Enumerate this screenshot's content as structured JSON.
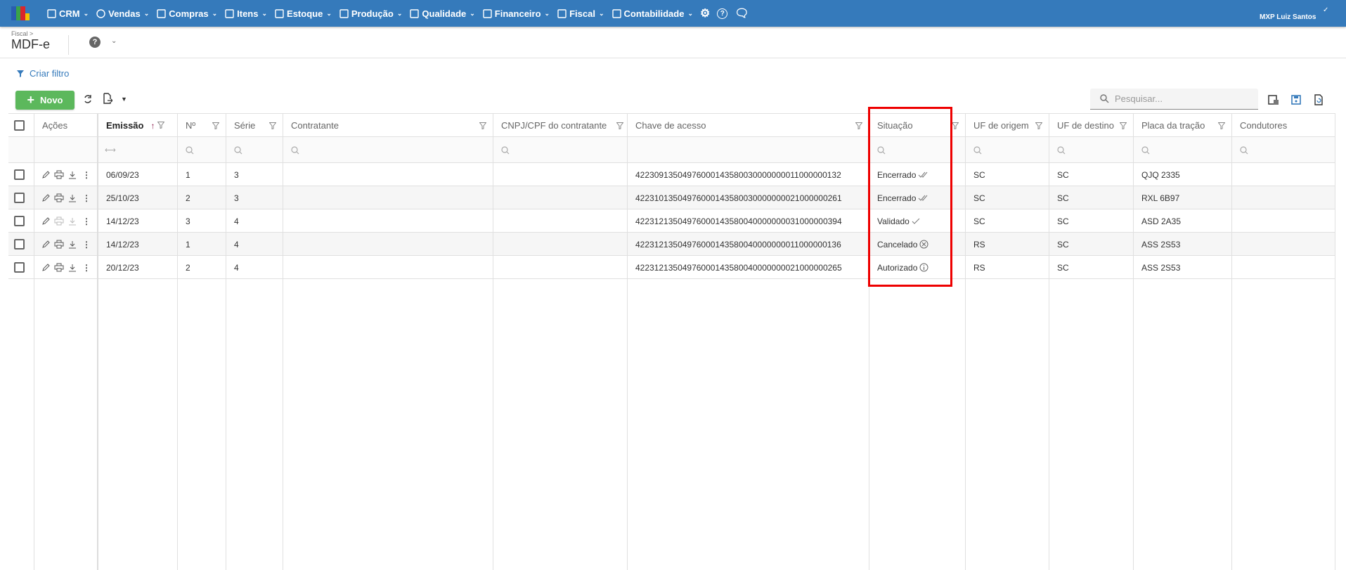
{
  "topbar": {
    "brand_colors": [
      "#2a5db0",
      "#3aa34a",
      "#d9262c",
      "#f4c400"
    ],
    "nav": [
      {
        "label": "CRM",
        "icon": "crm-icon"
      },
      {
        "label": "Vendas",
        "icon": "dollar-circle-icon"
      },
      {
        "label": "Compras",
        "icon": "cart-icon"
      },
      {
        "label": "Itens",
        "icon": "items-icon"
      },
      {
        "label": "Estoque",
        "icon": "stock-icon"
      },
      {
        "label": "Produção",
        "icon": "factory-icon"
      },
      {
        "label": "Qualidade",
        "icon": "checklist-icon"
      },
      {
        "label": "Financeiro",
        "icon": "money-bag-icon"
      },
      {
        "label": "Fiscal",
        "icon": "document-icon"
      },
      {
        "label": "Contabilidade",
        "icon": "calculator-icon"
      }
    ],
    "user": "MXP Luiz Santos"
  },
  "page": {
    "breadcrumb": "Fiscal >",
    "title": "MDF-e"
  },
  "toolbar": {
    "create_filter": "Criar filtro",
    "new_label": "Novo",
    "search_placeholder": "Pesquisar..."
  },
  "table": {
    "columns": [
      "Ações",
      "Emissão",
      "Nº",
      "Série",
      "Contratante",
      "CNPJ/CPF do contratante",
      "Chave de acesso",
      "Situação",
      "UF de origem",
      "UF de destino",
      "Placa da tração",
      "Condutores"
    ],
    "rows": [
      {
        "emissao": "06/09/23",
        "numero": "1",
        "serie": "3",
        "contratante": "",
        "cnpj": "",
        "chave": "42230913504976000143580030000000011000000132",
        "situacao": "Encerrado",
        "status_icon": "double-check",
        "uf_origem": "SC",
        "uf_destino": "SC",
        "placa": "QJQ 2335",
        "condutores": "",
        "print_enabled": true
      },
      {
        "emissao": "25/10/23",
        "numero": "2",
        "serie": "3",
        "contratante": "",
        "cnpj": "",
        "chave": "42231013504976000143580030000000021000000261",
        "situacao": "Encerrado",
        "status_icon": "double-check",
        "uf_origem": "SC",
        "uf_destino": "SC",
        "placa": "RXL 6B97",
        "condutores": "",
        "print_enabled": true
      },
      {
        "emissao": "14/12/23",
        "numero": "3",
        "serie": "4",
        "contratante": "",
        "cnpj": "",
        "chave": "42231213504976000143580040000000031000000394",
        "situacao": "Validado",
        "status_icon": "check",
        "uf_origem": "SC",
        "uf_destino": "SC",
        "placa": "ASD 2A35",
        "condutores": "",
        "print_enabled": false
      },
      {
        "emissao": "14/12/23",
        "numero": "1",
        "serie": "4",
        "contratante": "",
        "cnpj": "",
        "chave": "42231213504976000143580040000000011000000136",
        "situacao": "Cancelado",
        "status_icon": "circle-x",
        "uf_origem": "RS",
        "uf_destino": "SC",
        "placa": "ASS 2S53",
        "condutores": "",
        "print_enabled": true
      },
      {
        "emissao": "20/12/23",
        "numero": "2",
        "serie": "4",
        "contratante": "",
        "cnpj": "",
        "chave": "42231213504976000143580040000000021000000265",
        "situacao": "Autorizado",
        "status_icon": "circle-info",
        "uf_origem": "RS",
        "uf_destino": "SC",
        "placa": "ASS 2S53",
        "condutores": "",
        "print_enabled": true
      }
    ]
  },
  "colors": {
    "topbar": "#357abb",
    "primary_button": "#5cb85c",
    "highlight": "#ee0000",
    "sort_arrow": "#8b1a4a"
  }
}
